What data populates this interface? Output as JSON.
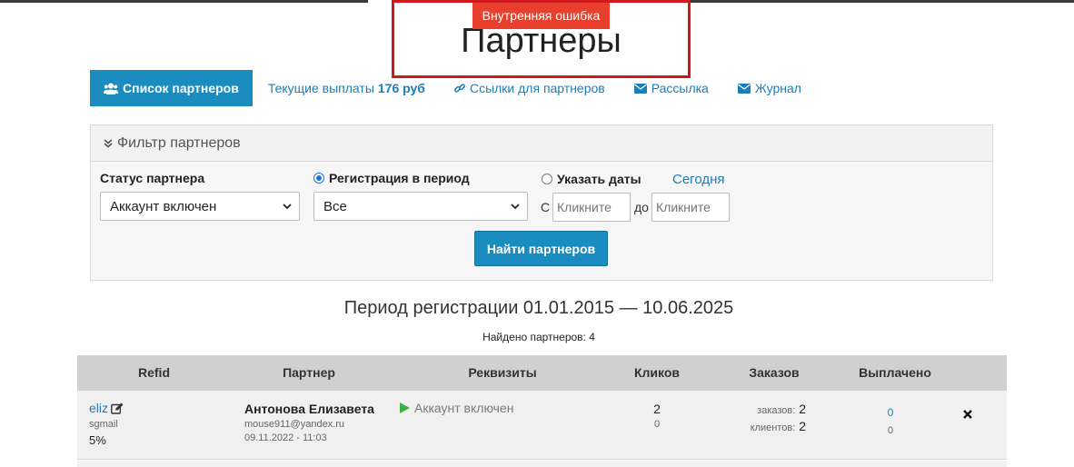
{
  "error": {
    "badge": "Внутренняя ошибка"
  },
  "page": {
    "title": "Партнеры"
  },
  "nav": {
    "partners_list": "Список партнеров",
    "current_payouts": "Текущие выплаты",
    "current_payouts_amount": "176 руб",
    "partner_links": "Ссылки для партнеров",
    "mailing": "Рассылка",
    "journal": "Журнал"
  },
  "filter": {
    "title": "Фильтр партнеров",
    "status_label": "Статус партнера",
    "status_value": "Аккаунт включен",
    "registration_label": "Регистрация в период",
    "registration_value": "Все",
    "dates_label": "Указать даты",
    "today": "Сегодня",
    "from_label": "С",
    "to_label": "до",
    "from_placeholder": "Кликните",
    "to_placeholder": "Кликните",
    "find_button": "Найти партнеров"
  },
  "summary": {
    "period": "Период регистрации 01.01.2015 — 10.06.2025",
    "found": "Найдено партнеров: 4"
  },
  "table": {
    "headers": [
      "Refid",
      "Партнер",
      "Реквизиты",
      "Кликов",
      "Заказов",
      "Выплачено"
    ],
    "rows": [
      {
        "refid": "eliz",
        "source": "sgmail",
        "percent": "5%",
        "name": "Антонова Елизавета",
        "email": "mouse911@yandex.ru",
        "date": "09.11.2022 - 11:03",
        "status": "Аккаунт включен",
        "clicks": "2",
        "clicks_sub": "0",
        "orders_label": "заказов:",
        "orders": "2",
        "clients_label": "клиентов:",
        "clients": "2",
        "paid": "0",
        "paid_sub": "0"
      }
    ]
  },
  "colors": {
    "accent": "#1a8cc0",
    "error": "#e8402c",
    "status_ok": "#3cb043"
  }
}
